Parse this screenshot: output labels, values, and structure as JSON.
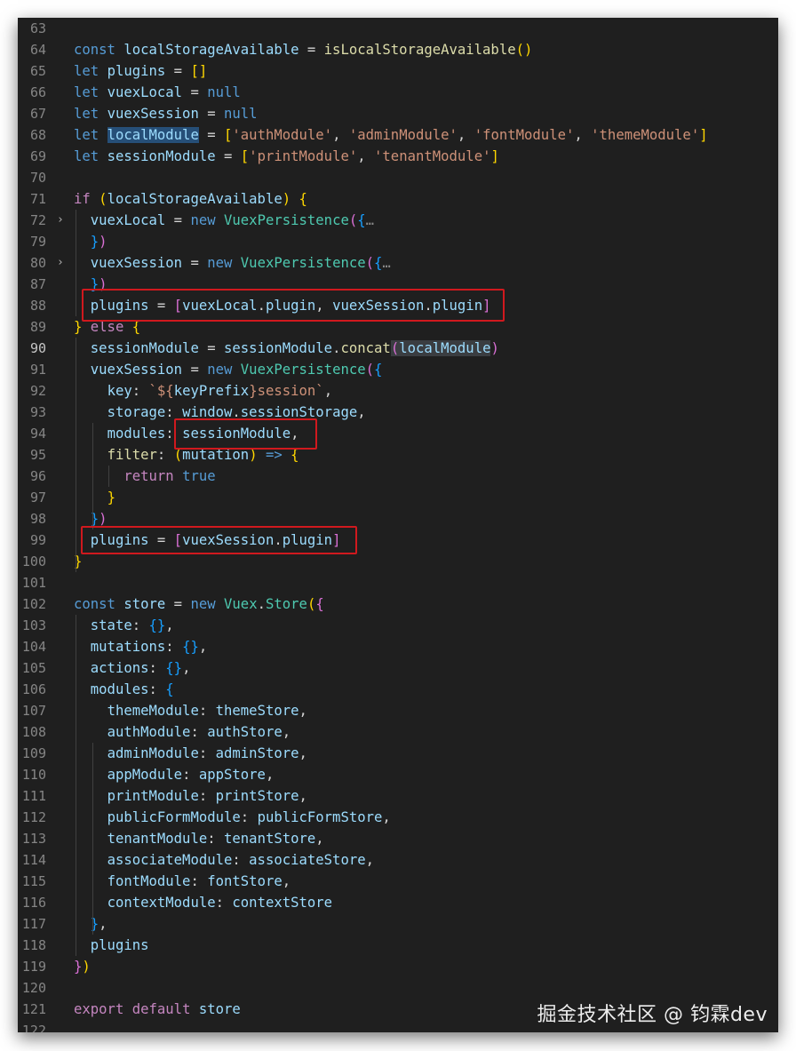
{
  "watermark": "掘金技术社区 @ 钧霖dev",
  "colors": {
    "background": "#1f1f1f",
    "highlight_box": "#d0191e",
    "keyword": "#569cd6",
    "variable": "#9cdcfe",
    "string": "#ce9178",
    "function": "#dcdcaa",
    "class": "#4ec9b0"
  },
  "lines": [
    {
      "n": "63",
      "tokens": []
    },
    {
      "n": "64",
      "tokens": [
        [
          "kw",
          "const"
        ],
        [
          "op",
          " "
        ],
        [
          "var",
          "localStorageAvailable"
        ],
        [
          "op",
          " = "
        ],
        [
          "fn",
          "isLocalStorageAvailable"
        ],
        [
          "br1",
          "()"
        ]
      ]
    },
    {
      "n": "65",
      "tokens": [
        [
          "kw",
          "let"
        ],
        [
          "op",
          " "
        ],
        [
          "var",
          "plugins"
        ],
        [
          "op",
          " = "
        ],
        [
          "br1",
          "[]"
        ]
      ]
    },
    {
      "n": "66",
      "tokens": [
        [
          "kw",
          "let"
        ],
        [
          "op",
          " "
        ],
        [
          "var",
          "vuexLocal"
        ],
        [
          "op",
          " = "
        ],
        [
          "kw",
          "null"
        ]
      ]
    },
    {
      "n": "67",
      "tokens": [
        [
          "kw",
          "let"
        ],
        [
          "op",
          " "
        ],
        [
          "var",
          "vuexSession"
        ],
        [
          "op",
          " = "
        ],
        [
          "kw",
          "null"
        ]
      ]
    },
    {
      "n": "68",
      "tokens": [
        [
          "kw",
          "let"
        ],
        [
          "op",
          " "
        ],
        [
          "var sel",
          "localModule"
        ],
        [
          "op",
          " = "
        ],
        [
          "br1",
          "["
        ],
        [
          "str",
          "'authModule'"
        ],
        [
          "op",
          ", "
        ],
        [
          "str",
          "'adminModule'"
        ],
        [
          "op",
          ", "
        ],
        [
          "str",
          "'fontModule'"
        ],
        [
          "op",
          ", "
        ],
        [
          "str",
          "'themeModule'"
        ],
        [
          "br1",
          "]"
        ]
      ]
    },
    {
      "n": "69",
      "tokens": [
        [
          "kw",
          "let"
        ],
        [
          "op",
          " "
        ],
        [
          "var",
          "sessionModule"
        ],
        [
          "op",
          " = "
        ],
        [
          "br1",
          "["
        ],
        [
          "str",
          "'printModule'"
        ],
        [
          "op",
          ", "
        ],
        [
          "str",
          "'tenantModule'"
        ],
        [
          "br1",
          "]"
        ]
      ]
    },
    {
      "n": "70",
      "tokens": []
    },
    {
      "n": "71",
      "tokens": [
        [
          "ctrl",
          "if"
        ],
        [
          "op",
          " "
        ],
        [
          "br1",
          "("
        ],
        [
          "var",
          "localStorageAvailable"
        ],
        [
          "br1",
          ")"
        ],
        [
          "op",
          " "
        ],
        [
          "br1",
          "{"
        ]
      ]
    },
    {
      "n": "72",
      "fold": true,
      "tokens": [
        [
          "op",
          "  "
        ],
        [
          "var",
          "vuexLocal"
        ],
        [
          "op",
          " = "
        ],
        [
          "kw",
          "new"
        ],
        [
          "op",
          " "
        ],
        [
          "cls",
          "VuexPersistence"
        ],
        [
          "br2",
          "("
        ],
        [
          "br3",
          "{"
        ],
        [
          "dim",
          "…"
        ]
      ]
    },
    {
      "n": "79",
      "tokens": [
        [
          "op",
          "  "
        ],
        [
          "br3",
          "}"
        ],
        [
          "br2",
          ")"
        ]
      ]
    },
    {
      "n": "80",
      "fold": true,
      "tokens": [
        [
          "op",
          "  "
        ],
        [
          "var",
          "vuexSession"
        ],
        [
          "op",
          " = "
        ],
        [
          "kw",
          "new"
        ],
        [
          "op",
          " "
        ],
        [
          "cls",
          "VuexPersistence"
        ],
        [
          "br2",
          "("
        ],
        [
          "br3",
          "{"
        ],
        [
          "dim",
          "…"
        ]
      ]
    },
    {
      "n": "87",
      "tokens": [
        [
          "op",
          "  "
        ],
        [
          "br3",
          "}"
        ],
        [
          "br2",
          ")"
        ]
      ]
    },
    {
      "n": "88",
      "tokens": [
        [
          "op",
          "  "
        ],
        [
          "var",
          "plugins"
        ],
        [
          "op",
          " = "
        ],
        [
          "br2",
          "["
        ],
        [
          "var",
          "vuexLocal"
        ],
        [
          "op",
          "."
        ],
        [
          "var",
          "plugin"
        ],
        [
          "op",
          ", "
        ],
        [
          "var",
          "vuexSession"
        ],
        [
          "op",
          "."
        ],
        [
          "var",
          "plugin"
        ],
        [
          "br2",
          "]"
        ]
      ]
    },
    {
      "n": "89",
      "tokens": [
        [
          "br1",
          "}"
        ],
        [
          "op",
          " "
        ],
        [
          "ctrl",
          "else"
        ],
        [
          "op",
          " "
        ],
        [
          "br1",
          "{"
        ]
      ]
    },
    {
      "n": "90",
      "current": true,
      "tokens": [
        [
          "op",
          "  "
        ],
        [
          "var",
          "sessionModule"
        ],
        [
          "op",
          " = "
        ],
        [
          "var",
          "sessionModule"
        ],
        [
          "op",
          "."
        ],
        [
          "fn",
          "concat"
        ],
        [
          "br2 selsoft",
          "("
        ],
        [
          "var selsoft",
          "localModule"
        ],
        [
          "br2",
          ")"
        ]
      ]
    },
    {
      "n": "91",
      "tokens": [
        [
          "op",
          "  "
        ],
        [
          "var",
          "vuexSession"
        ],
        [
          "op",
          " = "
        ],
        [
          "kw",
          "new"
        ],
        [
          "op",
          " "
        ],
        [
          "cls",
          "VuexPersistence"
        ],
        [
          "br2",
          "("
        ],
        [
          "br3",
          "{"
        ]
      ]
    },
    {
      "n": "92",
      "tokens": [
        [
          "op",
          "    "
        ],
        [
          "var",
          "key"
        ],
        [
          "op",
          ": "
        ],
        [
          "str",
          "`${"
        ],
        [
          "var",
          "keyPrefix"
        ],
        [
          "str",
          "}session`"
        ],
        [
          "op",
          ","
        ]
      ]
    },
    {
      "n": "93",
      "tokens": [
        [
          "op",
          "    "
        ],
        [
          "var",
          "storage"
        ],
        [
          "op",
          ": "
        ],
        [
          "var",
          "window"
        ],
        [
          "op",
          "."
        ],
        [
          "var",
          "sessionStorage"
        ],
        [
          "op",
          ","
        ]
      ]
    },
    {
      "n": "94",
      "tokens": [
        [
          "op",
          "    "
        ],
        [
          "var",
          "modules"
        ],
        [
          "op",
          ": "
        ],
        [
          "var",
          "sessionModule"
        ],
        [
          "op",
          ","
        ]
      ]
    },
    {
      "n": "95",
      "tokens": [
        [
          "op",
          "    "
        ],
        [
          "fn",
          "filter"
        ],
        [
          "op",
          ": "
        ],
        [
          "br1",
          "("
        ],
        [
          "var",
          "mutation"
        ],
        [
          "br1",
          ")"
        ],
        [
          "op",
          " "
        ],
        [
          "kw",
          "=>"
        ],
        [
          "op",
          " "
        ],
        [
          "br1",
          "{"
        ]
      ]
    },
    {
      "n": "96",
      "tokens": [
        [
          "op",
          "      "
        ],
        [
          "ctrl",
          "return"
        ],
        [
          "op",
          " "
        ],
        [
          "kw",
          "true"
        ]
      ]
    },
    {
      "n": "97",
      "tokens": [
        [
          "op",
          "    "
        ],
        [
          "br1",
          "}"
        ]
      ]
    },
    {
      "n": "98",
      "tokens": [
        [
          "op",
          "  "
        ],
        [
          "br3",
          "}"
        ],
        [
          "br2",
          ")"
        ]
      ]
    },
    {
      "n": "99",
      "tokens": [
        [
          "op",
          "  "
        ],
        [
          "var",
          "plugins"
        ],
        [
          "op",
          " = "
        ],
        [
          "br2",
          "["
        ],
        [
          "var",
          "vuexSession"
        ],
        [
          "op",
          "."
        ],
        [
          "var",
          "plugin"
        ],
        [
          "br2",
          "]"
        ]
      ]
    },
    {
      "n": "100",
      "tokens": [
        [
          "br1",
          "}"
        ]
      ]
    },
    {
      "n": "101",
      "tokens": []
    },
    {
      "n": "102",
      "tokens": [
        [
          "kw",
          "const"
        ],
        [
          "op",
          " "
        ],
        [
          "var",
          "store"
        ],
        [
          "op",
          " = "
        ],
        [
          "kw",
          "new"
        ],
        [
          "op",
          " "
        ],
        [
          "cls",
          "Vuex"
        ],
        [
          "op",
          "."
        ],
        [
          "cls",
          "Store"
        ],
        [
          "br1",
          "("
        ],
        [
          "br2",
          "{"
        ]
      ]
    },
    {
      "n": "103",
      "tokens": [
        [
          "op",
          "  "
        ],
        [
          "var",
          "state"
        ],
        [
          "op",
          ": "
        ],
        [
          "br3",
          "{}"
        ],
        [
          "op",
          ","
        ]
      ]
    },
    {
      "n": "104",
      "tokens": [
        [
          "op",
          "  "
        ],
        [
          "var",
          "mutations"
        ],
        [
          "op",
          ": "
        ],
        [
          "br3",
          "{}"
        ],
        [
          "op",
          ","
        ]
      ]
    },
    {
      "n": "105",
      "tokens": [
        [
          "op",
          "  "
        ],
        [
          "var",
          "actions"
        ],
        [
          "op",
          ": "
        ],
        [
          "br3",
          "{}"
        ],
        [
          "op",
          ","
        ]
      ]
    },
    {
      "n": "106",
      "tokens": [
        [
          "op",
          "  "
        ],
        [
          "var",
          "modules"
        ],
        [
          "op",
          ": "
        ],
        [
          "br3",
          "{"
        ]
      ]
    },
    {
      "n": "107",
      "tokens": [
        [
          "op",
          "    "
        ],
        [
          "var",
          "themeModule"
        ],
        [
          "op",
          ": "
        ],
        [
          "t3",
          "themeStore"
        ],
        [
          "op",
          ","
        ]
      ]
    },
    {
      "n": "108",
      "tokens": [
        [
          "op",
          "    "
        ],
        [
          "var",
          "authModule"
        ],
        [
          "op",
          ": "
        ],
        [
          "t3",
          "authStore"
        ],
        [
          "op",
          ","
        ]
      ]
    },
    {
      "n": "109",
      "tokens": [
        [
          "op",
          "    "
        ],
        [
          "var",
          "adminModule"
        ],
        [
          "op",
          ": "
        ],
        [
          "t3",
          "adminStore"
        ],
        [
          "op",
          ","
        ]
      ]
    },
    {
      "n": "110",
      "tokens": [
        [
          "op",
          "    "
        ],
        [
          "var",
          "appModule"
        ],
        [
          "op",
          ": "
        ],
        [
          "t3",
          "appStore"
        ],
        [
          "op",
          ","
        ]
      ]
    },
    {
      "n": "111",
      "tokens": [
        [
          "op",
          "    "
        ],
        [
          "var",
          "printModule"
        ],
        [
          "op",
          ": "
        ],
        [
          "t3",
          "printStore"
        ],
        [
          "op",
          ","
        ]
      ]
    },
    {
      "n": "112",
      "tokens": [
        [
          "op",
          "    "
        ],
        [
          "var",
          "publicFormModule"
        ],
        [
          "op",
          ": "
        ],
        [
          "t3",
          "publicFormStore"
        ],
        [
          "op",
          ","
        ]
      ]
    },
    {
      "n": "113",
      "tokens": [
        [
          "op",
          "    "
        ],
        [
          "var",
          "tenantModule"
        ],
        [
          "op",
          ": "
        ],
        [
          "t3",
          "tenantStore"
        ],
        [
          "op",
          ","
        ]
      ]
    },
    {
      "n": "114",
      "tokens": [
        [
          "op",
          "    "
        ],
        [
          "var",
          "associateModule"
        ],
        [
          "op",
          ": "
        ],
        [
          "t3",
          "associateStore"
        ],
        [
          "op",
          ","
        ]
      ]
    },
    {
      "n": "115",
      "tokens": [
        [
          "op",
          "    "
        ],
        [
          "var",
          "fontModule"
        ],
        [
          "op",
          ": "
        ],
        [
          "t3",
          "fontStore"
        ],
        [
          "op",
          ","
        ]
      ]
    },
    {
      "n": "116",
      "tokens": [
        [
          "op",
          "    "
        ],
        [
          "var",
          "contextModule"
        ],
        [
          "op",
          ": "
        ],
        [
          "t3",
          "contextStore"
        ]
      ]
    },
    {
      "n": "117",
      "tokens": [
        [
          "op",
          "  "
        ],
        [
          "br3",
          "}"
        ],
        [
          "op",
          ","
        ]
      ]
    },
    {
      "n": "118",
      "tokens": [
        [
          "op",
          "  "
        ],
        [
          "var",
          "plugins"
        ]
      ]
    },
    {
      "n": "119",
      "tokens": [
        [
          "br2",
          "}"
        ],
        [
          "br1",
          ")"
        ]
      ]
    },
    {
      "n": "120",
      "tokens": []
    },
    {
      "n": "121",
      "tokens": [
        [
          "ctrl",
          "export"
        ],
        [
          "op",
          " "
        ],
        [
          "ctrl",
          "default"
        ],
        [
          "op",
          " "
        ],
        [
          "var",
          "store"
        ]
      ]
    },
    {
      "n": "122",
      "tokens": []
    }
  ]
}
